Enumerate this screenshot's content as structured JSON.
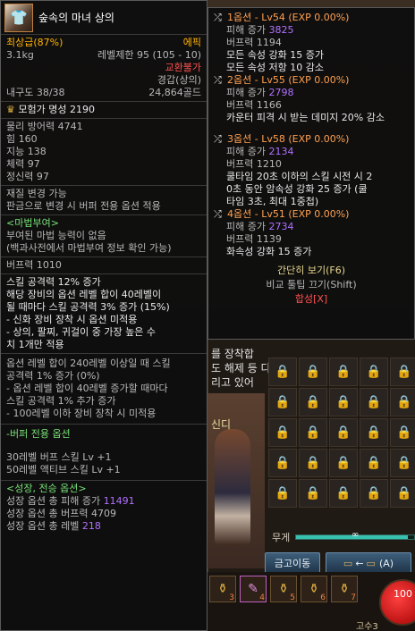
{
  "item": {
    "name": "숲속의 마녀 상의",
    "grade_label": "최상급(87%)",
    "rarity": "에픽",
    "weight": "3.1kg",
    "level_limit": "레벨제한 95 (105 - 10)",
    "trade": "교환불가",
    "armor_type": "경갑(상의)",
    "durability": "내구도 38/38",
    "price": "24,864골드",
    "fame": "모험가 명성 2190",
    "stats": [
      "물리 방어력 4741",
      "힘 160",
      "지능 138",
      "체력 97",
      "정신력 97"
    ],
    "material_change": [
      "재질 변경 가능",
      "판금으로 변경 시 버퍼 전용 옵션 적용"
    ],
    "enchant_header": "<마법부여>",
    "enchant_lines": [
      "부여된 마법 능력이 없음",
      "(백과사전에서 마법부여 정보 확인 가능)"
    ],
    "buff_power": "버프력 1010",
    "skill_attack": "스킬 공격력 12% 증가",
    "set_desc": [
      "해당 장비의 옵션 레벨 합이 40레벨이",
      "될 때마다 스킬 공격력 3% 증가 (15%)",
      "- 신화 장비 장착 시 옵션 미적용",
      "- 상의, 팔찌, 귀걸이 중 가장 높은 수",
      "치 1개만 적용"
    ],
    "option_level_desc": [
      "옵션 레벨 합이 240레벨 이상일 때 스킬",
      "공격력 1% 증가 (0%)",
      "- 옵션 레벨 합이 40레벨 증가할 때마다",
      "스킬 공격력 1% 추가 증가",
      "- 100레벨 이하 장비 장착 시 미적용"
    ],
    "buffer_header": "-버퍼 전용 옵션",
    "buffer_lines": [
      "30레벨 버프 스킬 Lv +1",
      "50레벨 액티브 스킬 Lv +1"
    ],
    "growth_header": "<성장, 전승 옵션>",
    "growth_lines": [
      {
        "label": "성장 옵션 총 피해 증가",
        "value": "11491"
      },
      {
        "label": "성장 옵션 총 버프력",
        "value": "4709"
      },
      {
        "label": "성장 옵션 총 레벨",
        "value": "218"
      }
    ]
  },
  "options": [
    {
      "title": "1옵션 - Lv54 (EXP 0.00%)",
      "damage_label": "피해 증가",
      "damage": "3825",
      "buff": "버프력 1194",
      "effects": [
        "모든 속성 강화 15 증가",
        "모든 속성 저항 10 감소"
      ]
    },
    {
      "title": "2옵션 - Lv55 (EXP 0.00%)",
      "damage_label": "피해 증가",
      "damage": "2798",
      "buff": "버프력 1166",
      "effects": [
        "카운터 피격 시 받는 데미지 20% 감소"
      ]
    },
    {
      "title": "3옵션 - Lv58 (EXP 0.00%)",
      "damage_label": "피해 증가",
      "damage": "2134",
      "buff": "버프력 1210",
      "effects": [
        "쿨타임 20초 이하의 스킬 시전 시 2",
        "0초 동안 암속성 강화 25 증가 (쿨",
        "타임 3초, 최대 1중첩)"
      ]
    },
    {
      "title": "4옵션 - Lv51 (EXP 0.00%)",
      "damage_label": "피해 증가",
      "damage": "2734",
      "buff": "버프력 1139",
      "effects": [
        "화속성 강화 15 증가"
      ]
    }
  ],
  "footer": {
    "simple_view": "간단히 보기(F6)",
    "compare": "비교 툴팁 끄기(Shift)",
    "compose": "합성[X]"
  },
  "scene": {
    "partial_lines": [
      "를 장착합",
      "도 해제 등 다",
      "리고 있어"
    ],
    "char_name": "신디",
    "weight_label": "무게",
    "weight_fill": 0.95,
    "weight_inf": "∞",
    "btn_storage": "금고이동",
    "btn_move": "(A)",
    "hp": "100",
    "rank": "고수3",
    "quick_nums": [
      "3",
      "4",
      "5",
      "6",
      "7"
    ]
  }
}
